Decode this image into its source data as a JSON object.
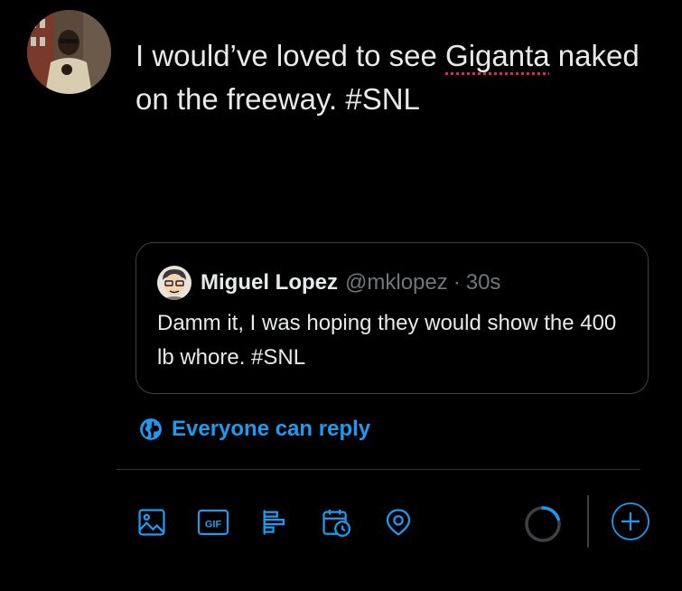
{
  "compose": {
    "text_before": "I would’ve loved to see ",
    "misspelled_word": "Giganta",
    "text_after": " naked on the freeway.  #SNL"
  },
  "quoted_tweet": {
    "name": "Miguel Lopez",
    "handle": "@mklopez",
    "separator": "·",
    "time": "30s",
    "text": "Damm it, I was hoping they would show the 400 lb whore. #SNL"
  },
  "reply_setting": {
    "label": "Everyone can reply",
    "icon": "globe-icon"
  },
  "toolbar": {
    "icons": [
      "image-icon",
      "gif-icon",
      "poll-icon",
      "schedule-icon",
      "location-icon"
    ],
    "gif_label": "GIF",
    "add_icon": "plus-icon"
  },
  "character_count": {
    "fraction_used": 0.2
  },
  "colors": {
    "accent": "#1d9bf0",
    "background": "#000000",
    "text": "#e7e9ea",
    "muted": "#71767b",
    "border": "#3e4144",
    "spellcheck": "#e0245e"
  }
}
